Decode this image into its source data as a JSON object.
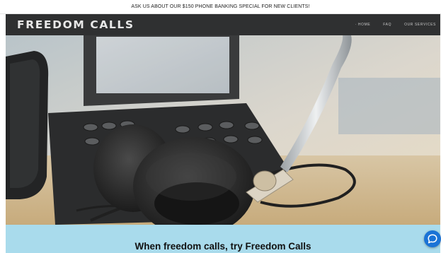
{
  "announcement": "ASK US ABOUT OUR $150 PHONE BANKING SPECIAL FOR NEW CLIENTS!",
  "brand": "FREEDOM CALLS",
  "nav": {
    "items": [
      "· HOME",
      "FAQ",
      "OUR SERVICES"
    ]
  },
  "hero": {
    "image_subject": "office desk phone with headset"
  },
  "tagline": "When freedom calls, try Freedom Calls",
  "chat": {
    "icon": "chat-bubble-icon"
  },
  "colors": {
    "navbar": "#2f3031",
    "tagline_band": "#a9dbec",
    "chat_button": "#1a73d6"
  }
}
